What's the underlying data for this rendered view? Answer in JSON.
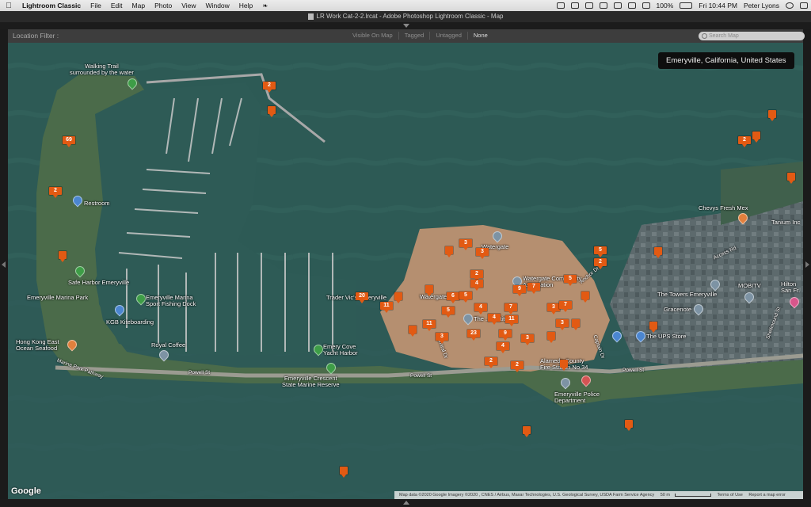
{
  "menubar": {
    "app_name": "Lightroom Classic",
    "items": [
      "File",
      "Edit",
      "Map",
      "Photo",
      "View",
      "Window",
      "Help"
    ],
    "battery": "100%",
    "clock": "Fri 10:44 PM",
    "user": "Peter Lyons"
  },
  "window": {
    "title": "LR Work Cat-2-2.lrcat - Adobe Photoshop Lightroom Classic - Map"
  },
  "filter_bar": {
    "label": "Location Filter :",
    "options": [
      {
        "label": "Visible On Map",
        "active": false
      },
      {
        "label": "Tagged",
        "active": false
      },
      {
        "label": "Untagged",
        "active": false
      },
      {
        "label": "None",
        "active": true
      }
    ],
    "search_placeholder": "Search Map"
  },
  "map": {
    "location_badge": "Emeryville, California, United States",
    "google_logo": "Google",
    "attribution": "Map data ©2020 Google Imagery ©2020 , CNES / Airbus, Maxar Technologies, U.S. Geological Survey, USDA Farm Service Agency",
    "scale": "50 m",
    "terms": "Terms of Use",
    "report": "Report a map error",
    "places": [
      {
        "id": "walking-trail",
        "text": "Walking Trail\nsurrounded by the water",
        "icon": "green"
      },
      {
        "id": "restroom",
        "text": "Restroom",
        "icon": "blue"
      },
      {
        "id": "safe-harbor",
        "text": "Safe Harbor Emeryville",
        "icon": "green"
      },
      {
        "id": "marina-park",
        "text": "Emeryville Marina Park",
        "icon": "none"
      },
      {
        "id": "sport-fishing",
        "text": "Emeryville Marina\nSport Fishing Dock",
        "icon": "green"
      },
      {
        "id": "kgb",
        "text": "KGB Kiteboarding",
        "icon": "blue"
      },
      {
        "id": "hong-kong",
        "text": "Hong Kong East\nOcean Seafood",
        "icon": "orange"
      },
      {
        "id": "royal-coffee",
        "text": "Royal Coffee",
        "icon": "gray"
      },
      {
        "id": "emery-cove",
        "text": "Emery Cove\nYacht Harbor",
        "icon": "green"
      },
      {
        "id": "crescent",
        "text": "Emeryville Crescent\nState Marine Reserve",
        "icon": "green"
      },
      {
        "id": "watergate",
        "text": "Watergate",
        "icon": "gray"
      },
      {
        "id": "watergate-community",
        "text": "Watergate Community\nAssociation",
        "icon": "gray"
      },
      {
        "id": "trader-vics",
        "text": "Trader Vic's Emeryville",
        "icon": "none"
      },
      {
        "id": "watergate-county",
        "text": "Watergate County",
        "icon": "none"
      },
      {
        "id": "institute",
        "text": "The ... Institute",
        "icon": "gray"
      },
      {
        "id": "chevys",
        "text": "Chevys Fresh Mex",
        "icon": "orange"
      },
      {
        "id": "tanium",
        "text": "Tanium Inc",
        "icon": "none"
      },
      {
        "id": "mobitv",
        "text": "MOBITV",
        "icon": "gray"
      },
      {
        "id": "towers",
        "text": "The Towers Emeryville",
        "icon": "gray"
      },
      {
        "id": "gracenote",
        "text": "Gracenote",
        "icon": "gray"
      },
      {
        "id": "ups",
        "text": "The UPS Store",
        "icon": "blue"
      },
      {
        "id": "hilton",
        "text": "Hilton\nSan Fr.",
        "icon": "pink"
      },
      {
        "id": "fire-station",
        "text": "Alameda County\nFire Station No 34",
        "icon": "gray"
      },
      {
        "id": "police",
        "text": "Emeryville Police\nDepartment",
        "icon": "red"
      }
    ],
    "streets": [
      "Powell St",
      "Powell St",
      "Powell St",
      "Shellmound St",
      "Access Rd",
      "Anchor Dr",
      "Admiral Dr",
      "Captain Dr",
      "Marina Park Pathway"
    ],
    "photo_markers": [
      "2",
      "",
      "69",
      "2",
      "",
      "",
      "2",
      "",
      "",
      "3",
      "3",
      "2",
      "4",
      "5",
      "2",
      "5",
      "7",
      "6",
      "5",
      "9",
      "11",
      "20",
      "11",
      "4",
      "5",
      "7",
      "3",
      "7",
      "4",
      "3",
      "11",
      "23",
      "9",
      "3",
      "4",
      "3",
      "2",
      "2",
      "",
      "",
      "",
      "",
      "",
      "",
      "",
      "",
      "",
      "",
      ""
    ]
  }
}
